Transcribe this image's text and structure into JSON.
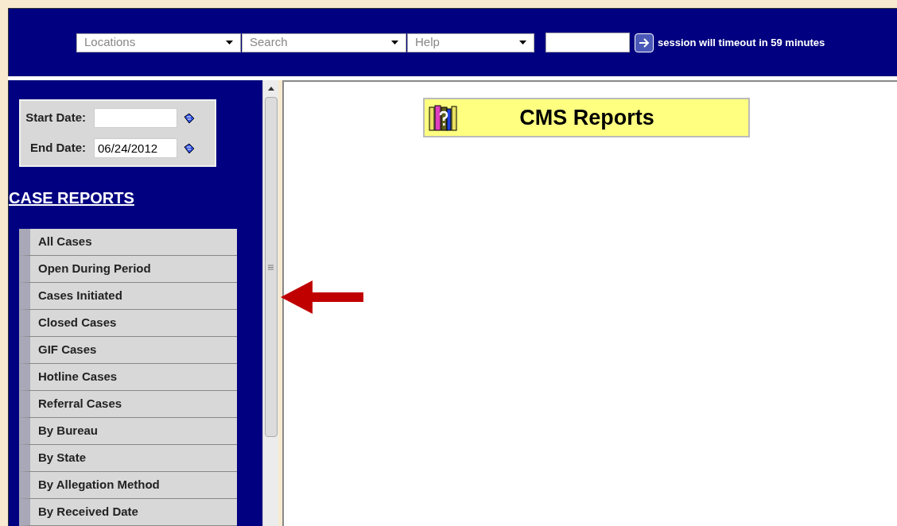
{
  "header": {
    "menus": [
      {
        "label": "Locations"
      },
      {
        "label": "Search"
      },
      {
        "label": "Help"
      }
    ],
    "session_text": "session will timeout in 59 minutes"
  },
  "dates": [
    {
      "label": "Start Date:"
    },
    {
      "label": "End Date:",
      "value": "06/24/2012"
    }
  ],
  "section_title": "CASE REPORTS",
  "reports": [
    "All Cases",
    "Open During Period",
    "Cases Initiated",
    "Closed Cases",
    "GIF Cases",
    "Hotline Cases",
    "Referral Cases",
    "By Bureau",
    "By State",
    "By Allegation Method",
    "By Received Date"
  ],
  "main": {
    "title": "CMS Reports"
  }
}
